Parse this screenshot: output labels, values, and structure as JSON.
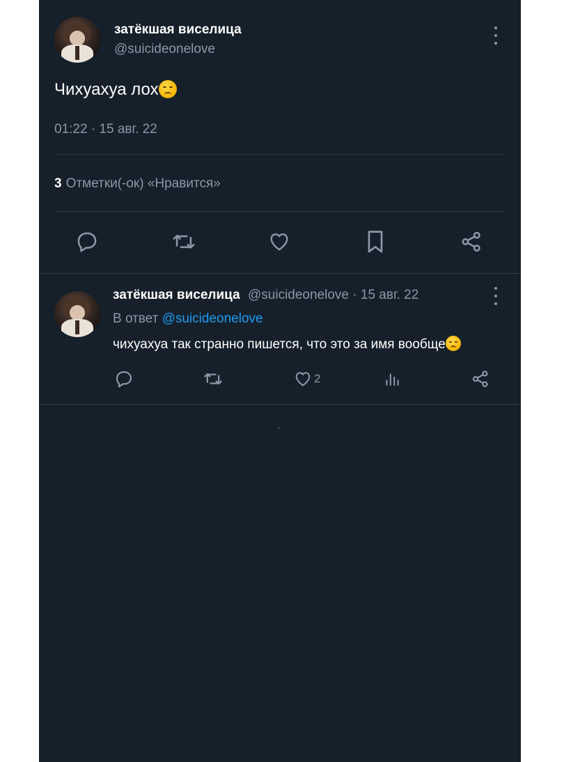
{
  "tweet": {
    "author_name": "затёкшая виселица",
    "author_handle": "@suicideonelove",
    "text": "Чихуахуа лох",
    "timestamp": "01:22 · 15 авг. 22",
    "likes_count": "3",
    "likes_label": "Отметки(-ок) «Нравится»",
    "actions": [
      "reply-icon",
      "retweet-icon",
      "heart-icon",
      "bookmark-icon",
      "share-icon"
    ]
  },
  "reply": {
    "author_name": "затёкшая виселица",
    "author_handle": "@suicideonelove",
    "date": "· 15 авг. 22",
    "reply_prefix": "В ответ",
    "reply_mention": "@suicideonelove",
    "text": "чихуахуа так странно пишется, что это за имя вообще",
    "like_count": "2",
    "actions": [
      "reply-icon",
      "retweet-icon",
      "heart-icon",
      "analytics-icon",
      "share-icon"
    ]
  },
  "colors": {
    "background": "#15202b",
    "text_primary": "#ffffff",
    "text_secondary": "#8b98a5",
    "accent": "#1d9bf0",
    "divider": "#2f3a45"
  }
}
